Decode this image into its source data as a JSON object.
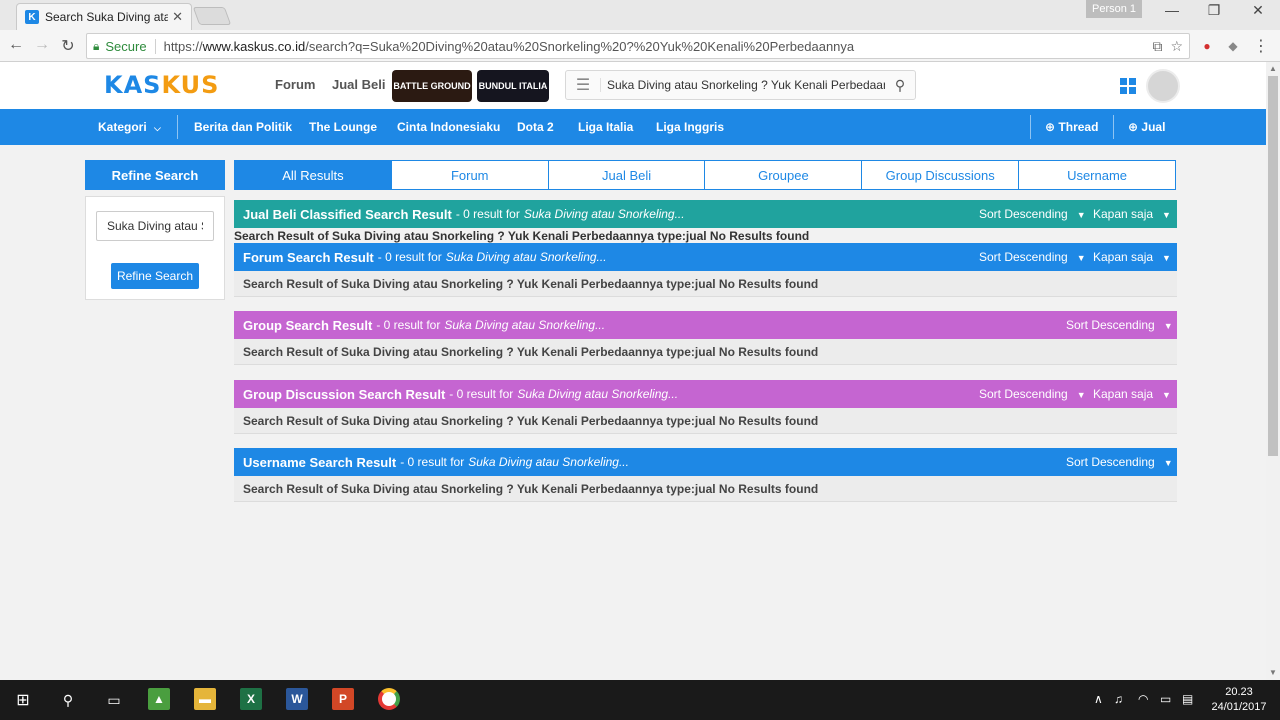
{
  "browser": {
    "tab_title": "Search Suka Diving atau Snorkeling",
    "tab_favicon": "K",
    "person": "Person 1",
    "secure_label": "Secure",
    "url_scheme": "https://",
    "url_host": "www.kaskus.co.id",
    "url_path": "/search?q=Suka%20Diving%20atau%20Snorkeling%20?%20Yuk%20Kenali%20Perbedaannya"
  },
  "header": {
    "logo_a": "KAS",
    "logo_b": "KUS",
    "forum": "Forum",
    "jual_beli": "Jual Beli",
    "badge_battle": "BATTLE GROUND",
    "badge_bundul": "BUNDUL ITALIA",
    "search_value": "Suka Diving atau Snorkeling ? Yuk Kenali Perbedaannya"
  },
  "nav": {
    "kategori": "Kategori",
    "items": [
      "Berita dan Politik",
      "The Lounge",
      "Cinta Indonesiaku",
      "Dota 2",
      "Liga Italia",
      "Liga Inggris"
    ],
    "thread": "Thread",
    "jual": "Jual"
  },
  "sidebar": {
    "title": "Refine Search",
    "input_value": "Suka Diving atau S",
    "button": "Refine Search"
  },
  "tabs": [
    "All Results",
    "Forum",
    "Jual Beli",
    "Groupee",
    "Group Discussions",
    "Username"
  ],
  "loose_message": "Search Result of Suka Diving atau Snorkeling ? Yuk Kenali Perbedaannya type:jual No Results found",
  "sections": [
    {
      "title": "Jual Beli Classified Search Result",
      "count": "- 0 result for",
      "term": "Suka Diving atau Snorkeling...",
      "sort": "Sort Descending",
      "time": "Kapan saja",
      "message": "",
      "color": "#20a39e"
    },
    {
      "title": "Forum Search Result",
      "count": "- 0 result for",
      "term": "Suka Diving atau Snorkeling...",
      "sort": "Sort Descending",
      "time": "Kapan saja",
      "message": "Search Result of Suka Diving atau Snorkeling ? Yuk Kenali Perbedaannya type:jual No Results found",
      "color": "#1e88e5"
    },
    {
      "title": "Group Search Result",
      "count": "- 0 result for",
      "term": "Suka Diving atau Snorkeling...",
      "sort": "Sort Descending",
      "time": "",
      "message": "Search Result of Suka Diving atau Snorkeling ? Yuk Kenali Perbedaannya type:jual No Results found",
      "color": "#c565d1"
    },
    {
      "title": "Group Discussion Search Result",
      "count": "- 0 result for",
      "term": "Suka Diving atau Snorkeling...",
      "sort": "Sort Descending",
      "time": "Kapan saja",
      "message": "Search Result of Suka Diving atau Snorkeling ? Yuk Kenali Perbedaannya type:jual No Results found",
      "color": "#c565d1"
    },
    {
      "title": "Username Search Result",
      "count": "- 0 result for",
      "term": "Suka Diving atau Snorkeling...",
      "sort": "Sort Descending",
      "time": "",
      "message": "Search Result of Suka Diving atau Snorkeling ? Yuk Kenali Perbedaannya type:jual No Results found",
      "color": "#1e88e5"
    }
  ],
  "taskbar": {
    "time": "20.23",
    "date": "24/01/2017",
    "excel": "X",
    "word": "W",
    "ppt": "P"
  },
  "colors": {
    "brand_blue": "#1e88e5",
    "brand_orange": "#f39c12",
    "teal": "#20a39e",
    "purple": "#c565d1"
  }
}
